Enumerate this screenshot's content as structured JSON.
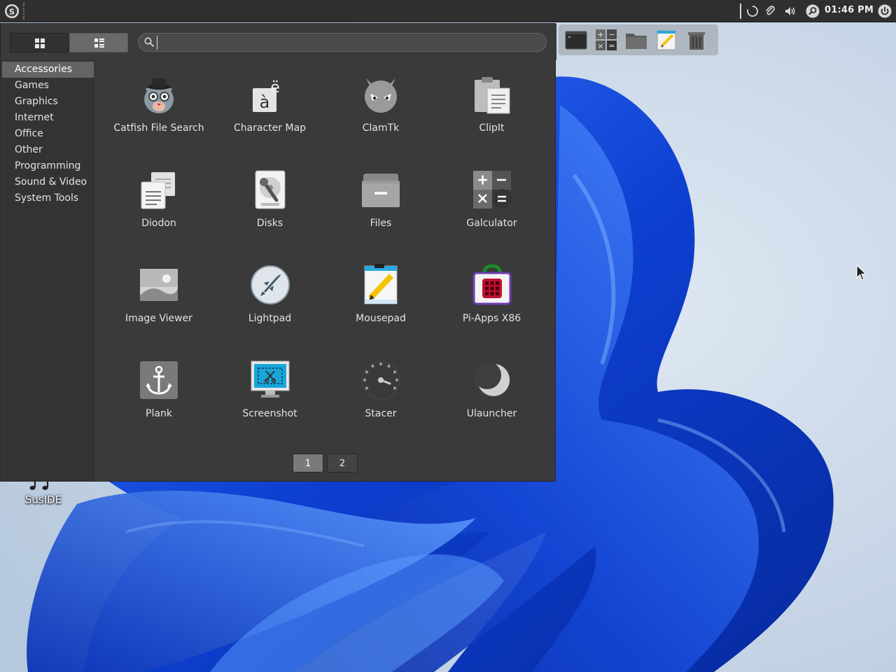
{
  "panel": {
    "clock": "01:46 PM",
    "tray_icons": [
      "spinner-icon",
      "clip-icon",
      "volume-icon",
      "search-icon",
      "power-icon"
    ]
  },
  "dock": {
    "items": [
      "terminal-icon",
      "calculator-icon",
      "folder-icon",
      "notepad-icon",
      "trash-icon"
    ]
  },
  "desktop": {
    "icon_label": "SusIDE"
  },
  "menu": {
    "search": {
      "value": "",
      "placeholder": ""
    },
    "categories": [
      "Accessories",
      "Games",
      "Graphics",
      "Internet",
      "Office",
      "Other",
      "Programming",
      "Sound & Video",
      "System Tools"
    ],
    "selected_category": "Accessories",
    "apps": [
      "Catfish File Search",
      "Character Map",
      "ClamTk",
      "ClipIt",
      "Diodon",
      "Disks",
      "Files",
      "Galculator",
      "Image Viewer",
      "Lightpad",
      "Mousepad",
      "Pi-Apps X86",
      "Plank",
      "Screenshot",
      "Stacer",
      "Ulauncher"
    ],
    "pages": [
      "1",
      "2"
    ],
    "current_page": "1",
    "charmap_glyphs": [
      "à",
      "ë"
    ]
  },
  "colors": {
    "panel_bg": "#2f2f2f",
    "menu_bg": "#3a3a3a",
    "sidebar_bg": "#333333",
    "selected_bg": "#646464",
    "wallpaper_blue": "#1d4fd8"
  }
}
